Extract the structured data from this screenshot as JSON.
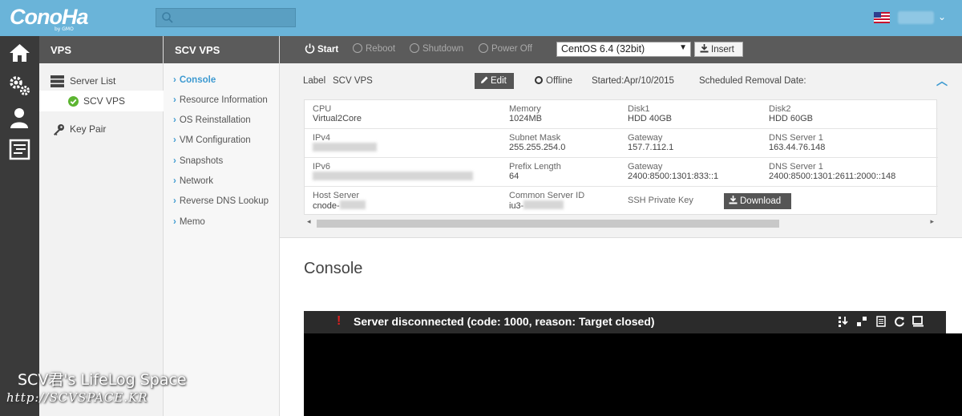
{
  "header": {
    "logo": "ConoHa",
    "logo_sub": "by GMO",
    "search_placeholder": ""
  },
  "nav": {
    "col1_title": "VPS",
    "server_list": "Server List",
    "server_item": "SCV VPS",
    "key_pair": "Key Pair",
    "col2_title": "SCV VPS",
    "menu": [
      "Console",
      "Resource Information",
      "OS Reinstallation",
      "VM Configuration",
      "Snapshots",
      "Network",
      "Reverse DNS Lookup",
      "Memo"
    ]
  },
  "toolbar": {
    "start": "Start",
    "reboot": "Reboot",
    "shutdown": "Shutdown",
    "power_off": "Power Off",
    "os_select": "CentOS 6.4 (32bit)",
    "insert": "Insert"
  },
  "info": {
    "label_key": "Label",
    "label_value": "SCV VPS",
    "edit": "Edit",
    "status": "Offline",
    "started": "Started:Apr/10/2015",
    "removal": "Scheduled Removal Date:",
    "rows": [
      [
        {
          "k": "CPU",
          "v": "Virtual2Core"
        },
        {
          "k": "Memory",
          "v": "1024MB"
        },
        {
          "k": "Disk1",
          "v": "HDD 40GB"
        },
        {
          "k": "Disk2",
          "v": "HDD 60GB"
        }
      ],
      [
        {
          "k": "IPv4",
          "v": ""
        },
        {
          "k": "Subnet Mask",
          "v": "255.255.254.0"
        },
        {
          "k": "Gateway",
          "v": "157.7.112.1"
        },
        {
          "k": "DNS Server 1",
          "v": "163.44.76.148"
        }
      ],
      [
        {
          "k": "IPv6",
          "v": ""
        },
        {
          "k": "Prefix Length",
          "v": "64"
        },
        {
          "k": "Gateway",
          "v": "2400:8500:1301:833::1"
        },
        {
          "k": "DNS Server 1",
          "v": "2400:8500:1301:2611:2000::148"
        }
      ],
      [
        {
          "k": "Host Server",
          "v": "cnode-"
        },
        {
          "k": "Common Server ID",
          "v": "iu3-"
        },
        {
          "k": "SSH Private Key",
          "v": ""
        }
      ]
    ],
    "download": "Download"
  },
  "console": {
    "title": "Console",
    "message": "Server disconnected (code: 1000, reason: Target closed)"
  },
  "watermark": {
    "line1": "SCV君's LifeLog Space",
    "line2": "http://SCVSPACE.KR"
  },
  "colors": {
    "header": "#6ab4d9",
    "accent": "#3d9ad1",
    "dark": "#5b5b5b",
    "success": "#5cb531"
  }
}
